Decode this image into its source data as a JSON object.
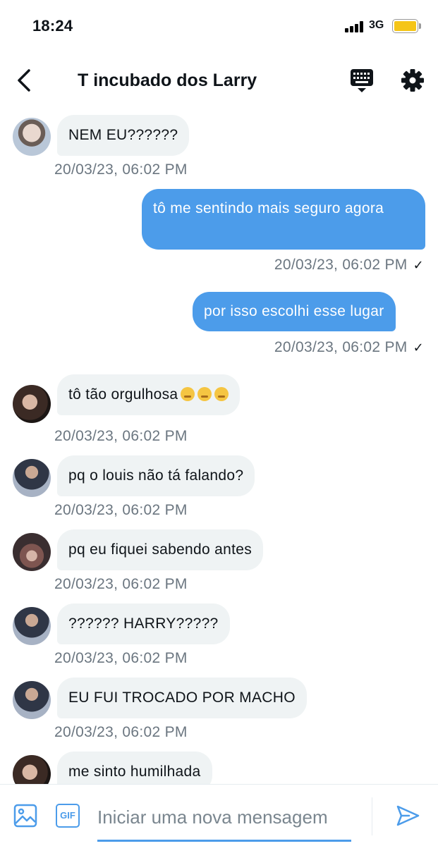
{
  "status_bar": {
    "time": "18:24",
    "network": "3G"
  },
  "header": {
    "title": "T incubado dos Larry",
    "back_icon": "chevron-left-icon",
    "keyboard_icon": "keyboard-icon",
    "settings_icon": "gear-icon"
  },
  "colors": {
    "accent": "#4c9cea",
    "incoming_bubble": "#eff3f4",
    "timestamp": "#6b7680",
    "battery": "#f5c518"
  },
  "messages": [
    {
      "direction": "in",
      "text": "NEM EU??????",
      "time": "20/03/23, 06:02 PM"
    },
    {
      "direction": "out",
      "text": "tô me sentindo mais seguro agora",
      "time": "20/03/23, 06:02 PM",
      "status": "✓"
    },
    {
      "direction": "out",
      "text": "por isso escolhi esse lugar",
      "time": "20/03/23, 06:02 PM",
      "status": "✓"
    },
    {
      "direction": "in",
      "text": "tô tão orgulhosa",
      "time": "20/03/23, 06:02 PM"
    },
    {
      "direction": "in",
      "text": "pq o louis não tá falando?",
      "time": "20/03/23, 06:02 PM"
    },
    {
      "direction": "in",
      "text": "pq eu fiquei sabendo antes",
      "time": "20/03/23, 06:02 PM"
    },
    {
      "direction": "in",
      "text": "?????? HARRY?????",
      "time": "20/03/23, 06:02 PM"
    },
    {
      "direction": "in",
      "text": "EU FUI TROCADO POR MACHO",
      "time": "20/03/23, 06:02 PM"
    },
    {
      "direction": "in",
      "text": "me sinto humilhada",
      "time": ""
    }
  ],
  "composer": {
    "placeholder": "Iniciar uma nova mensagem",
    "image_icon": "image-icon",
    "gif_label": "GIF",
    "send_icon": "send-icon"
  }
}
